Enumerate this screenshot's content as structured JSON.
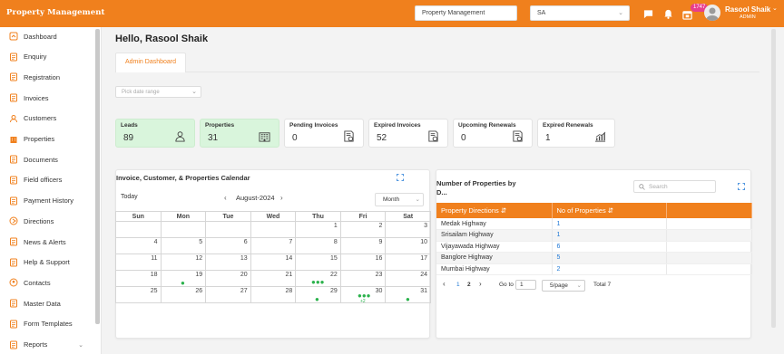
{
  "header": {
    "brand": "Property Management",
    "select_one": "Property Management",
    "select_two": "SA",
    "notification_count": "1747",
    "user_name": "Rasool Shaik",
    "user_role": "ADMIN"
  },
  "sidebar": {
    "items": [
      {
        "label": "Dashboard",
        "icon": "dashboard-icon"
      },
      {
        "label": "Enquiry",
        "icon": "enquiry-icon"
      },
      {
        "label": "Registration",
        "icon": "registration-icon"
      },
      {
        "label": "Invoices",
        "icon": "invoice-icon"
      },
      {
        "label": "Customers",
        "icon": "customers-icon"
      },
      {
        "label": "Properties",
        "icon": "building-icon"
      },
      {
        "label": "Documents",
        "icon": "documents-icon"
      },
      {
        "label": "Field officers",
        "icon": "officer-icon"
      },
      {
        "label": "Payment History",
        "icon": "payment-icon"
      },
      {
        "label": "Directions",
        "icon": "directions-icon"
      },
      {
        "label": "News & Alerts",
        "icon": "news-icon"
      },
      {
        "label": "Help & Support",
        "icon": "help-icon"
      },
      {
        "label": "Contacts",
        "icon": "contacts-icon"
      },
      {
        "label": "Master Data",
        "icon": "master-data-icon"
      },
      {
        "label": "Form Templates",
        "icon": "form-templates-icon"
      },
      {
        "label": "Reports",
        "icon": "reports-icon"
      }
    ]
  },
  "main": {
    "greeting": "Hello, Rasool Shaik",
    "tab_label": "Admin Dashboard",
    "date_range_placeholder": "Pick date range"
  },
  "cards": [
    {
      "label": "Leads",
      "value": "89",
      "icon": "leads-icon"
    },
    {
      "label": "Properties",
      "value": "31",
      "icon": "building-icon"
    },
    {
      "label": "Pending Invoices",
      "value": "0",
      "icon": "invoice-icon"
    },
    {
      "label": "Expired Invoices",
      "value": "52",
      "icon": "invoice-icon"
    },
    {
      "label": "Upcoming Renewals",
      "value": "0",
      "icon": "invoice-icon"
    },
    {
      "label": "Expired Renewals",
      "value": "1",
      "icon": "chart-icon"
    }
  ],
  "calendar": {
    "title": "Invoice, Customer, & Properties Calendar",
    "today_label": "Today",
    "month_label": "August-2024",
    "view": "Month",
    "weekdays": [
      "Sun",
      "Mon",
      "Tue",
      "Wed",
      "Thu",
      "Fri",
      "Sat"
    ],
    "weeks": [
      [
        "",
        "",
        "",
        "",
        "1",
        "2",
        "3"
      ],
      [
        "4",
        "5",
        "6",
        "7",
        "8",
        "9",
        "10"
      ],
      [
        "11",
        "12",
        "13",
        "14",
        "15",
        "16",
        "17"
      ],
      [
        "18",
        "19",
        "20",
        "21",
        "22",
        "23",
        "24"
      ],
      [
        "25",
        "26",
        "27",
        "28",
        "29",
        "30",
        "31"
      ]
    ],
    "more_label": "+2"
  },
  "properties_panel": {
    "title_line1": "Number of Properties by",
    "title_line2": "D...",
    "search_placeholder": "Search",
    "col_direction": "Property Directions",
    "col_count": "No of Properties",
    "rows": [
      {
        "direction": "Medak Highway",
        "count": "1"
      },
      {
        "direction": "Srisailam Highway",
        "count": "1"
      },
      {
        "direction": "Vijayawada Highway",
        "count": "6"
      },
      {
        "direction": "Banglore Highway",
        "count": "5"
      },
      {
        "direction": "Mumbai Highway",
        "count": "2"
      }
    ],
    "page_1": "1",
    "page_2": "2",
    "goto_label": "Go to",
    "goto_value": "1",
    "page_size": "5/page",
    "total": "Total 7"
  },
  "colors": {
    "accent": "#f0801d",
    "green_card": "#d9f5dc",
    "link": "#1e78d6",
    "event_dot": "#2bb24c"
  }
}
